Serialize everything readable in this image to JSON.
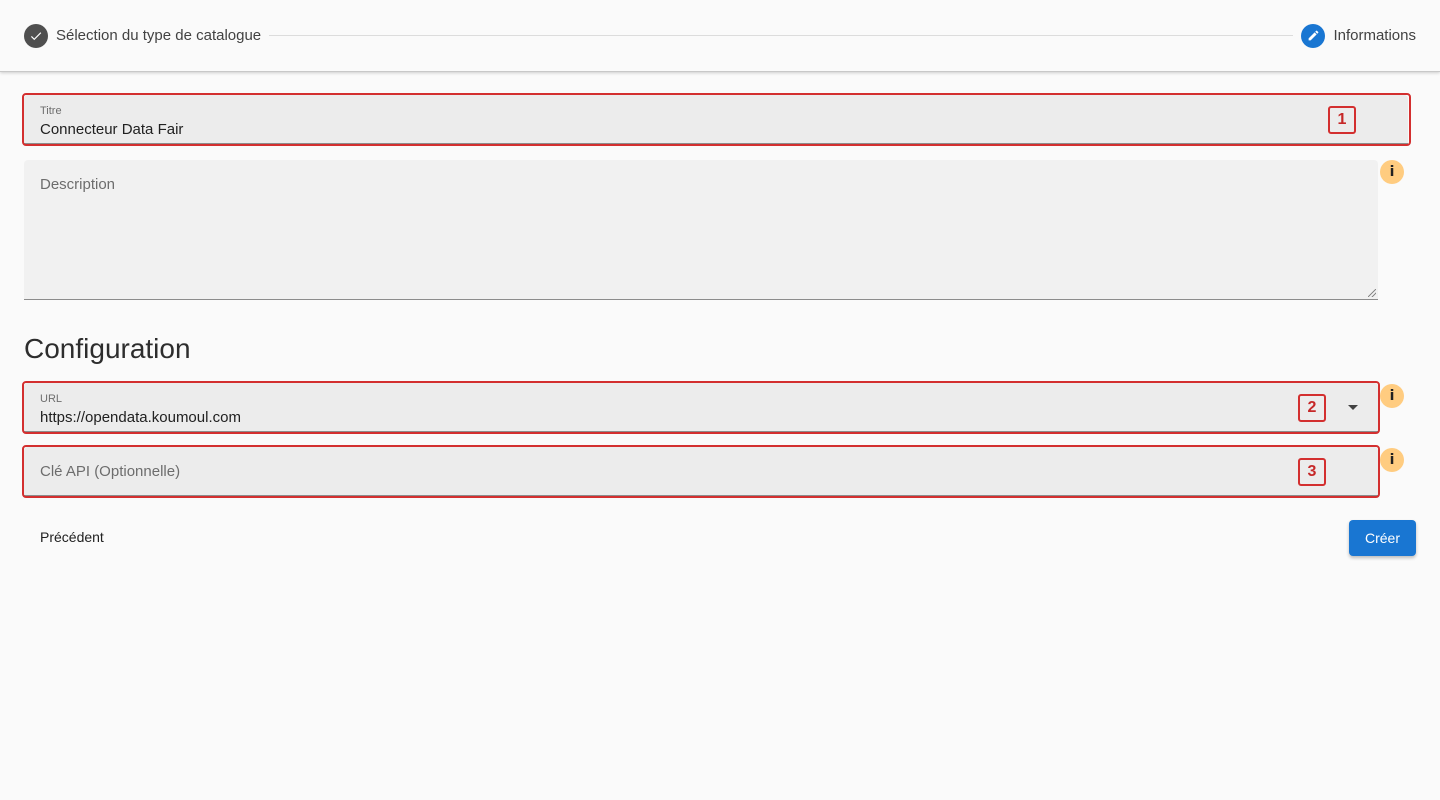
{
  "stepper": {
    "steps": [
      {
        "label": "Sélection du type de catalogue",
        "state": "done",
        "icon": "check-icon"
      },
      {
        "label": "Informations",
        "state": "active",
        "icon": "pencil-icon"
      }
    ]
  },
  "form": {
    "title_field": {
      "label": "Titre",
      "value": "Connecteur Data Fair"
    },
    "description_field": {
      "label": "Description",
      "value": ""
    },
    "section_title": "Configuration",
    "url_field": {
      "label": "URL",
      "value": "https://opendata.koumoul.com"
    },
    "api_key_field": {
      "label": "Clé API (Optionnelle)",
      "value": ""
    }
  },
  "annotations": [
    "1",
    "2",
    "3"
  ],
  "info_icon_glyph": "i",
  "actions": {
    "previous_label": "Précédent",
    "create_label": "Créer"
  },
  "colors": {
    "primary": "#1976d2",
    "annotation": "#d32f2f",
    "info": "#ffcc80",
    "step_done": "#4f4f4f"
  }
}
